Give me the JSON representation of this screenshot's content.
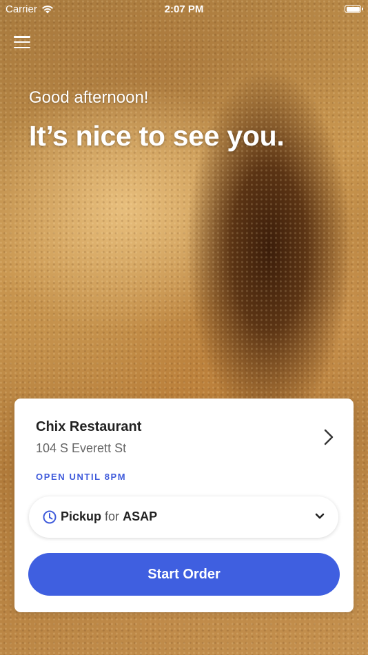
{
  "status_bar": {
    "carrier": "Carrier",
    "time": "2:07 PM",
    "wifi_icon": "wifi-icon",
    "battery_icon": "battery-icon",
    "battery_level": 1.0
  },
  "header": {
    "menu_icon": "hamburger-menu-icon",
    "greeting": "Good afternoon!",
    "headline": "It’s nice to see you."
  },
  "location_card": {
    "restaurant_name": "Chix Restaurant",
    "address": "104 S Everett St",
    "hours": "OPEN UNTIL 8PM",
    "chevron_icon": "chevron-right-icon",
    "order_selector": {
      "clock_icon": "clock-icon",
      "mode": "Pickup",
      "connector": "for",
      "time": "ASAP",
      "dropdown_icon": "chevron-down-icon"
    },
    "start_button_label": "Start Order"
  },
  "colors": {
    "accent": "#3f5fe0",
    "hours_text": "#3f5bdb",
    "card_background": "#ffffff"
  }
}
